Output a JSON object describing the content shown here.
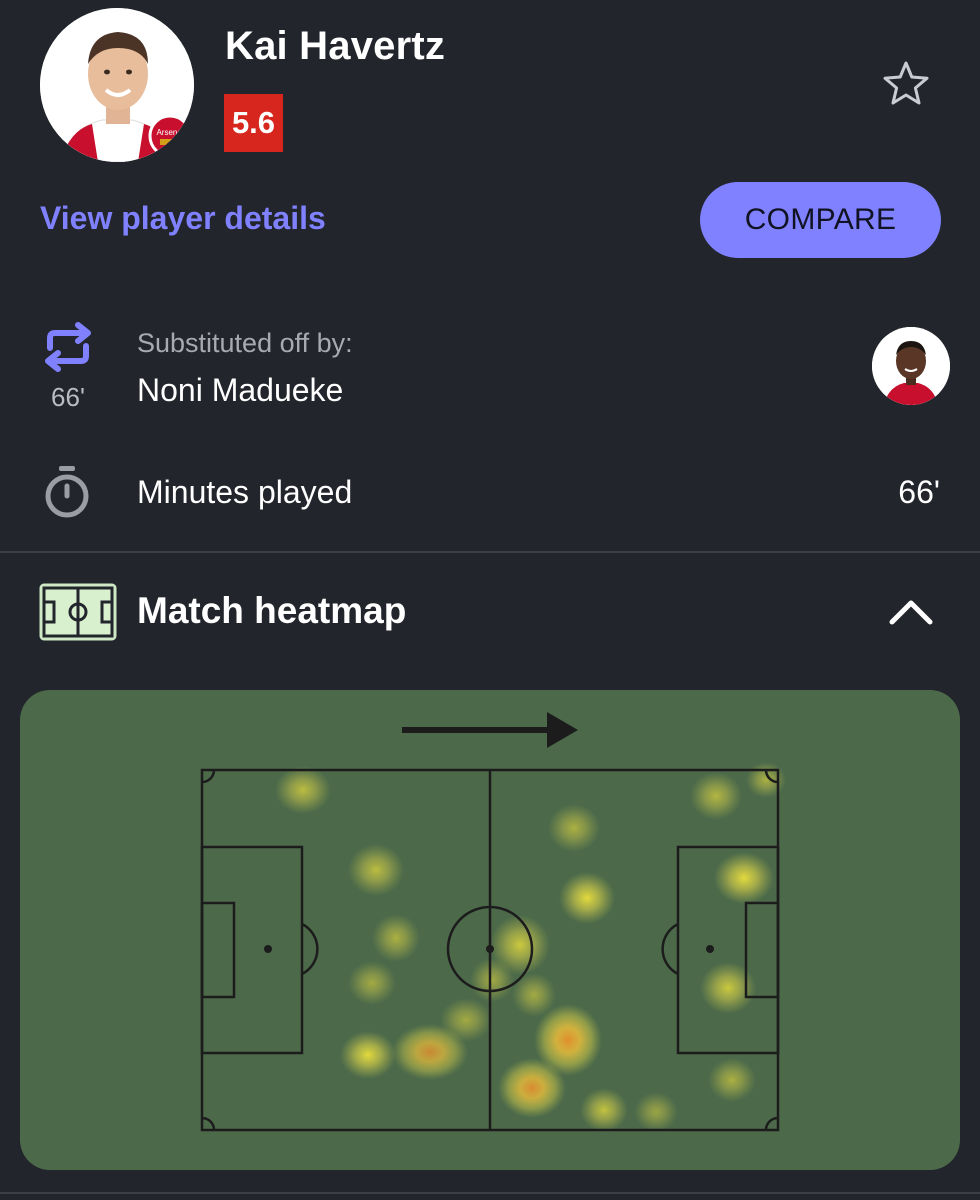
{
  "player": {
    "name": "Kai Havertz",
    "rating": "5.6",
    "club_badge_text": "Arsenal",
    "rating_color": "#d7261e"
  },
  "actions": {
    "details_label": "View player details",
    "compare_label": "COMPARE",
    "favorite_icon": "star-outline-icon",
    "accent_color": "#7f81ff"
  },
  "substitution": {
    "label": "Substituted off by:",
    "player": "Noni Madueke",
    "minute": "66'",
    "icon": "substitution-arrows-icon"
  },
  "minutes": {
    "label": "Minutes played",
    "value": "66'",
    "icon": "stopwatch-icon"
  },
  "heatmap": {
    "title": "Match heatmap",
    "icon": "pitch-icon",
    "toggle_icon": "chevron-up-icon",
    "direction_icon": "attack-direction-arrow-icon",
    "colors": {
      "background": "#4c6a4a",
      "low": "#e8e04a",
      "high": "#f0a030"
    }
  }
}
